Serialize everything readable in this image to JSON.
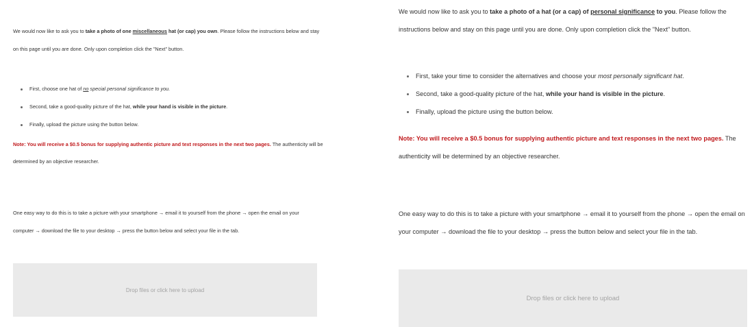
{
  "left": {
    "intro": {
      "a": "We would now like to ask you to ",
      "b": "take a photo of one ",
      "c": "miscellaneous",
      "d": " hat (or cap) you own",
      "e": ". Please follow the instructions below and stay on this page until you are done. Only upon completion click the \"Next\" button."
    },
    "bullets": {
      "first_a": "First, choose one hat of ",
      "first_b": "no",
      "first_c": " special personal significance to you.",
      "second_a": "Second, take a good-quality picture of the hat, ",
      "second_b": "while your hand is visible in the picture",
      "second_c": ".",
      "third": "Finally, upload the picture using the button below."
    },
    "note": {
      "red": "Note: You will receive a $0.5 bonus for supplying authentic picture and text responses in the next two pages.",
      "rest": " The authenticity will be determined by an objective researcher."
    },
    "easy": "One easy way to do this is to take a picture with your smartphone → email it to yourself from the phone → open the email on your computer → download the file to your desktop → press the button below and select your file in the tab.",
    "dropzone": "Drop files or click here to upload"
  },
  "right": {
    "intro": {
      "a": "We would now like to ask you to ",
      "b": "take a photo of a hat (or a cap) of ",
      "c": "personal significance",
      "d": " to you",
      "e": ". Please follow the instructions below and stay on this page until you are done. Only upon completion click the \"Next\" button."
    },
    "bullets": {
      "first_a": "First, take your time to consider the alternatives and choose your ",
      "first_b": "most personally significant hat",
      "first_c": ".",
      "second_a": "Second, take a good-quality picture of the hat, ",
      "second_b": "while your hand is visible in the picture",
      "second_c": ".",
      "third": "Finally, upload the picture using the button below."
    },
    "note": {
      "red": "Note: You will receive a $0.5 bonus for supplying authentic picture and text responses in the next two pages.",
      "rest": " The authenticity will be determined by an objective researcher."
    },
    "easy": "One easy way to do this is to take a picture with your smartphone → email it to yourself from the phone → open the email on your computer → download the file to your desktop → press the button below and select your file in the tab.",
    "dropzone": "Drop files or click here to upload"
  },
  "colors": {
    "note_red": "#c0191c",
    "text": "#333333",
    "dropzone_bg": "#eaeaea",
    "dropzone_text": "#a3a3a3"
  }
}
